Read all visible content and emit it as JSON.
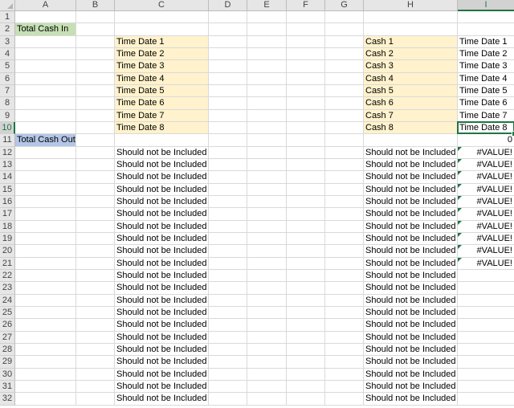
{
  "columns": [
    "A",
    "B",
    "C",
    "D",
    "E",
    "F",
    "G",
    "H",
    "I"
  ],
  "selected_column": "I",
  "selected_row": 10,
  "first_row": 1,
  "row_count": 32,
  "colors": {
    "label_green": "#c6e0b4",
    "label_blue": "#b4c6e7",
    "date_cream": "#fff2cc",
    "accent": "#217346"
  },
  "labels": {
    "total_cash_in": "Total Cash In",
    "total_cash_out": "Total Cash Out"
  },
  "dates": [
    "Time Date 1",
    "Time Date 2",
    "Time Date 3",
    "Time Date 4",
    "Time Date 5",
    "Time Date 6",
    "Time Date 7",
    "Time Date 8"
  ],
  "cash": [
    "Cash 1",
    "Cash 2",
    "Cash 3",
    "Cash 4",
    "Cash 5",
    "Cash 6",
    "Cash 7",
    "Cash 8"
  ],
  "excluded_text": "Should not be Included",
  "excluded_first_row": 12,
  "excluded_last_row": 32,
  "sum_value": "0",
  "error_value": "#VALUE!",
  "error_first_row": 12,
  "error_last_row": 21
}
